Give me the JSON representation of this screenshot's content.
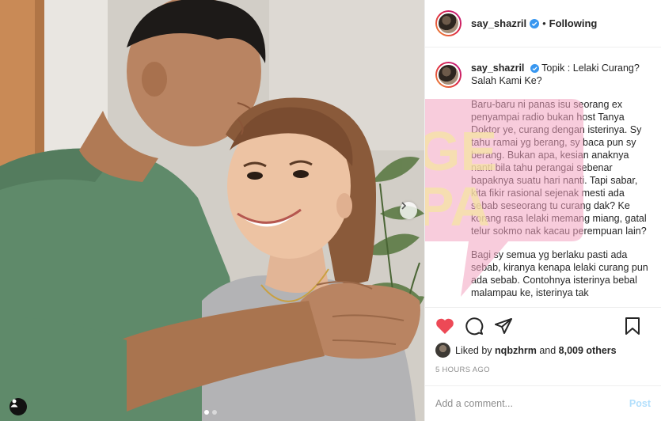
{
  "header": {
    "username": "say_shazril",
    "separator": "•",
    "follow_status": "Following"
  },
  "caption": {
    "username": "say_shazril",
    "title": "Topik : Lelaki Curang? Salah Kami Ke?",
    "paragraph_1": "Baru-baru ni panas isu seorang ex penyampai radio bukan host Tanya Doktor ye, curang dengan isterinya. Sy tahu ramai yg berang, sy baca pun sy berang. Bukan apa, kesian anaknya nanti bila tahu perangai sebenar bapaknya suatu hari nanti. Tapi sabar, kita fikir rasional sejenak mesti ada sebab seseorang tu curang dak? Ke korang rasa lelaki memang miang, gatal telur sokmo nak kacau perempuan lain?",
    "paragraph_2": "Bagi sy semua yg berlaku pasti ada sebab, kiranya kenapa lelaki curang pun ada sebab. Contohnya isterinya bebal malampau ke, isterinya tak"
  },
  "watermark": {
    "text_line_1": "GE",
    "text_line_2": "PA"
  },
  "likes": {
    "prefix": "Liked by",
    "user": "nqbzhrm",
    "conjunction": "and",
    "count": "8,009 others"
  },
  "time_ago": "5 HOURS AGO",
  "comment_box": {
    "placeholder": "Add a comment...",
    "post_label": "Post"
  },
  "carousel": {
    "slide_count": 2,
    "active_index": 0
  },
  "colors": {
    "like_red": "#ed4956",
    "verified_blue": "#3897f0",
    "post_button_disabled": "#b2dffc",
    "muted_text": "#8e8e8e"
  },
  "icons": {
    "like": "heart-filled-icon",
    "comment": "comment-bubble-icon",
    "share": "paper-plane-icon",
    "save": "bookmark-icon",
    "next": "chevron-right-icon",
    "tags": "user-tag-icon"
  }
}
